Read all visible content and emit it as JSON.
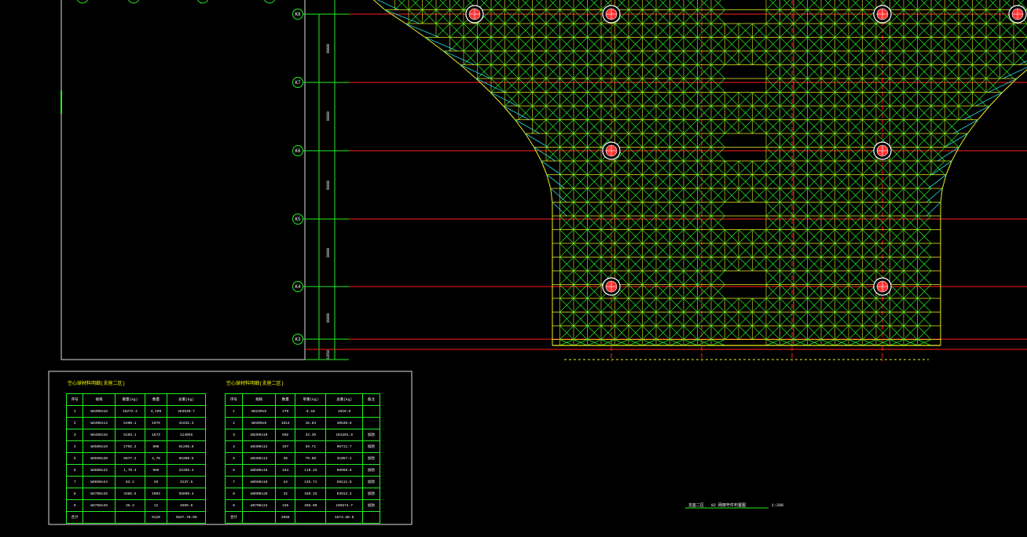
{
  "colors": {
    "background": "#000000",
    "axis_line": "#ff2020",
    "mesh_green": "#22ee22",
    "mesh_yellow": "#eeee22",
    "mesh_cyan": "#22dddd",
    "support": "#ff3030",
    "frame": "#ffffff"
  },
  "axis_labels": [
    "K8",
    "K7",
    "K6",
    "K5",
    "K4",
    "K3"
  ],
  "dimension_labels": [
    "9000",
    "9000",
    "9000",
    "9000",
    "8000",
    "1850"
  ],
  "schedule_left": {
    "title": "空心球材料明细(支座二区)",
    "header": [
      "序号",
      "规格",
      "重量(kg)",
      "数量",
      "总重(kg)"
    ],
    "rows": [
      [
        "1",
        "WS400x16",
        "16272.4",
        "4,199",
        "283539.7"
      ],
      [
        "2",
        "WS400x14",
        "5400.1",
        "1976",
        "41632.3"
      ],
      [
        "3",
        "WS450x16",
        "5103.1",
        "1673",
        "114055"
      ],
      [
        "4",
        "WS500x18",
        "2702.2",
        "808",
        "61295.6"
      ],
      [
        "5",
        "WS550x20",
        "5677.2",
        "4,70",
        "65309.5"
      ],
      [
        "6",
        "WS600x22",
        "1,70.3",
        "969",
        "22365.4"
      ],
      [
        "7",
        "WS650x24",
        "83.2",
        "29",
        "3137.5"
      ],
      [
        "8",
        "WS700x26",
        "4385.5",
        "1003",
        "55809.4"
      ],
      [
        "9",
        "WS750x28",
        "35.3",
        "12",
        "4509.8"
      ]
    ],
    "total_label": "合计",
    "total_count": "9120",
    "total_weight": "3837.70.09"
  },
  "schedule_right": {
    "title": "空心球材料明细(支座二区)",
    "header": [
      "序号",
      "规格",
      "数量",
      "单重(kg)",
      "总重(kg)",
      "备注"
    ],
    "rows": [
      [
        "1",
        "WS220x6",
        "279",
        "6.18",
        "1610.6",
        ""
      ],
      [
        "2",
        "WS300x8",
        "1814",
        "16.83",
        "40530.8",
        ""
      ],
      [
        "3",
        "WS350x10",
        "602",
        "34.39",
        "101201.8",
        "加肋"
      ],
      [
        "4",
        "WS400x12",
        "167",
        "53.71",
        "96711.7",
        "加肋"
      ],
      [
        "5",
        "WS450x14",
        "38",
        "79.60",
        "31057.2",
        "加肋"
      ],
      [
        "6",
        "WS500x16",
        "164",
        "119.33",
        "60050.6",
        "加肋"
      ],
      [
        "7",
        "WS550x18",
        "44",
        "135.71",
        "59111.8",
        "加肋"
      ],
      [
        "8",
        "WS600x20",
        "32",
        "189.33",
        "63912.2",
        "加肋"
      ],
      [
        "9",
        "WS700x24",
        "165",
        "298.00",
        "105674.7",
        "加肋"
      ]
    ],
    "total_label": "合计",
    "total_count": "2956",
    "total_weight": "1574.50.6"
  },
  "drawing_title": {
    "prefix": "支座二区",
    "name": "02 网架杆件布置图",
    "scale": "1:200"
  }
}
